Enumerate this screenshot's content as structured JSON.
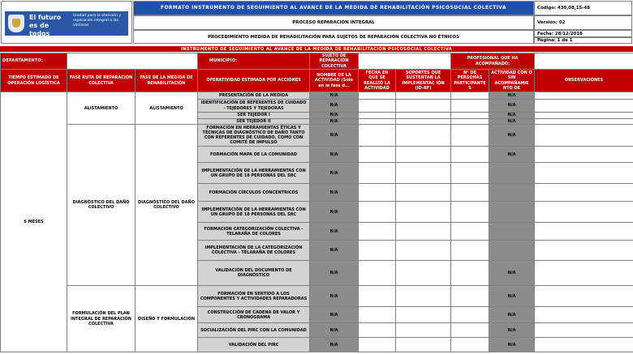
{
  "logo": {
    "brand": "El futuro es de todos",
    "entity": "Unidad para la atención y reparación integral a las víctimas"
  },
  "header": {
    "title": "FORMATO INSTRUMENTO DE SEGUIMIENTO AL AVANCE DE LA MEDIDA DE REHABILITACIÓN PSICOSOCIAL COLECTIVA",
    "process": "PROCESO REPARACIÓN INTEGRAL",
    "procedure": "PROCEDIMIENTO MEDIDA DE REHABILITACIÓN PARA SUJETOS DE REPARACIÓN COLECTIVA NO ÉTNICOS",
    "code": "Código: 430,08,15-48",
    "version": "Versión: 02",
    "date": "Fecha: 28/12/2018",
    "page": "Página: 1 de 1"
  },
  "banner": "INSTRUMENTO DE SEGUIMIENTO AL AVANCE DE LA MEDIDA DE REHABILITACIÓN PSICOSOCIAL COLECTIVA",
  "filters": {
    "department_label": "DEPARTAMENTO:",
    "municipality_label": "MUNICIPIO:",
    "sujeto_label": "SUJETO DE REPARACIÓN COLECTIVA",
    "professional_label": "PROFESIONAL QUE HA ACOMPAÑADO:"
  },
  "columns": {
    "time": "TIEMPO ESTIMADO DE OPERACIÓN LOGÍSTICA",
    "route_phase": "FASE RUTA DE REPARACIÓN COLECTIVA",
    "measure_phase": "FASE DE LA MEDIDA DE REHABILITACIÓN",
    "operativity": "OPERATIVIDAD ESTIMADA POR ACCIONES",
    "activity_name": "NOMBRE DE LA ACTIVIDAD (Solo en la fase d...",
    "date": "FECHA EN QUE SE REALIZÓ LA ACTIVIDAD",
    "support": "SOPORTES QUE SUSTENTAN LA IMPLEMENTAC IÓN (ID-RF)",
    "participants": "N° DE PERSONAS PARTICIPANTE S",
    "accompaniment": "ACTIVIDAD CON O SIN ACOMPAÑAMIE NTO DE",
    "observations": "OBSERVACIONES"
  },
  "time_value": "6 MESES",
  "phases": {
    "alistamiento_route": "ALISTAMIENTO",
    "alistamiento_measure": "ALISTAMIENTO",
    "diagnostico_route": "DIAGNÓSTICO DEL DAÑO COLECTIVO",
    "diagnostico_measure": "DIAGNÓSTICO DEL DAÑO COLECTIVO",
    "formulacion_route": "FORMULACIÓN DEL PLAN INTEGRAL DE REPARACIÓN COLECTIVA",
    "formulacion_measure": "DISEÑO Y FORMULACIÓN"
  },
  "na": "N/A",
  "activities": [
    "PRESENTACIÓN DE LA MEDIDA",
    "IDENTIFICACIÓN DE REFERENTES DE CUIDADO - TEJEDORES Y TEJEDORAS",
    "SER TEJEDOR I",
    "SER TEJEDOR II",
    "FORMACIÓN EN HERRAMIENTAS ÉTICAS Y TÉCNICAS DE DIAGNÓSTICO DE DAÑO TANTO CON REFERENTES DE CUIDADO, COMO CON COMITÉ DE IMPULSO",
    "FORMACIÓN MAPA DE LA COMUNIDAD",
    "IMPLEMENTACIÓN DE LA HERRAMIENTAS CON UN GRUPO DE 18 PERSONAS DEL SRC",
    "FORMACIÓN CÍRCULOS CONCÉNTRICOS",
    "IMPLEMENTACIÓN DE LA HERRAMIENTAS CON UN GRUPO DE 18 PERSONAS DEL SRC",
    "FORMACIÓN CATEGORIZACIÓN COLECTIVA - TELARAÑA DE COLORES",
    "IMPLEMENTACIÓN DE LA CATEGORIZACIÓN COLECTIVA - TELARAÑA DE COLORES",
    "VALIDACIÓN DEL DOCUMENTO DE DIAGNÓSTICO",
    "FORMACIÓN EN SENTIDO A LOS COMPONENTES Y ACTIVIDADES REPARADORAS",
    "CONSTRUCCIÓN DE CADENA DE VALOR Y CRONOGRAMA",
    "SOCIALIZACIÓN DEL PIRC CON LA COMUNIDAD",
    "VALIDACIÓN DEL PIRC"
  ]
}
